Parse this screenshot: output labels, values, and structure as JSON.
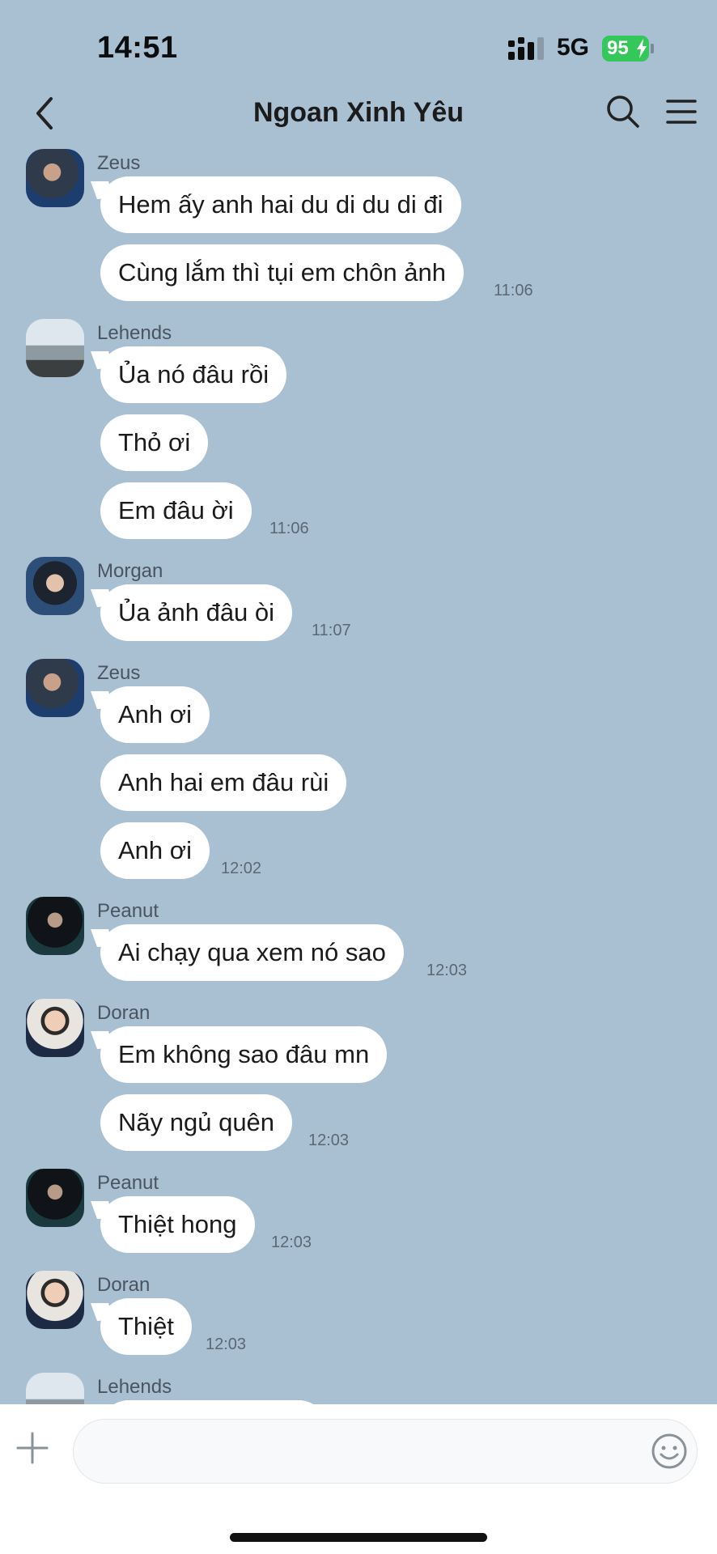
{
  "status_bar": {
    "time": "14:51",
    "network": "5G",
    "battery": "95"
  },
  "header": {
    "title": "Ngoan Xinh Yêu"
  },
  "messages": [
    {
      "sender": "Zeus",
      "bubbles": [
        "Hem ấy anh hai du di du di đi",
        "Cùng lắm thì tụi em chôn ảnh"
      ],
      "time": "11:06"
    },
    {
      "sender": "Lehends",
      "bubbles": [
        "Ủa nó đâu rồi",
        "Thỏ ơi",
        "Em đâu ời"
      ],
      "time": "11:06"
    },
    {
      "sender": "Morgan",
      "bubbles": [
        "Ủa ảnh đâu òi"
      ],
      "time": "11:07"
    },
    {
      "sender": "Zeus",
      "bubbles": [
        "Anh ơi",
        "Anh hai em đâu rùi",
        "Anh ơi"
      ],
      "time": "12:02"
    },
    {
      "sender": "Peanut",
      "bubbles": [
        "Ai chạy qua xem nó sao"
      ],
      "time": "12:03"
    },
    {
      "sender": "Doran",
      "bubbles": [
        "Em không sao đâu mn",
        "Nãy ngủ quên"
      ],
      "time": "12:03"
    },
    {
      "sender": "Peanut",
      "bubbles": [
        "Thiệt hong"
      ],
      "time": "12:03"
    },
    {
      "sender": "Doran",
      "bubbles": [
        "Thiệt"
      ],
      "time": "12:03"
    },
    {
      "sender": "Lehends",
      "bubbles": [],
      "time": ""
    }
  ],
  "input": {
    "placeholder": ""
  },
  "colors": {
    "background": "#a9bfd2",
    "bubble": "#ffffff",
    "battery": "#34c759"
  },
  "icons": [
    "back-icon",
    "search-icon",
    "menu-icon",
    "plus-icon",
    "emoji-icon"
  ]
}
